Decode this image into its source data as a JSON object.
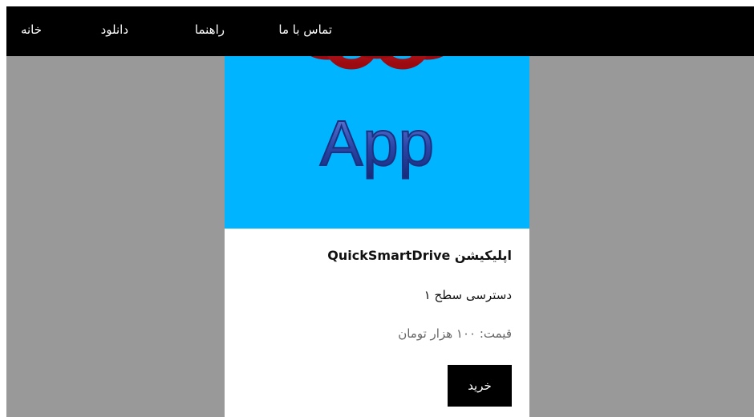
{
  "nav": {
    "contact": "تماس با ما",
    "guide": "راهنما",
    "download": "دانلود",
    "home": "خانه"
  },
  "product": {
    "image_text": "App",
    "image_icon": "red-knot-logo-icon",
    "title": "اپلیکیشن QuickSmartDrive",
    "access": "دسترسی سطح ۱",
    "price": "قیمت: ۱۰۰ هزار تومان",
    "buy_label": "خرید"
  },
  "colors": {
    "page_background": "#999999",
    "navbar": "#000000",
    "image_background": "#00b4ff",
    "logo_red": "#c8141c",
    "logo_text": "#2a46a8"
  }
}
